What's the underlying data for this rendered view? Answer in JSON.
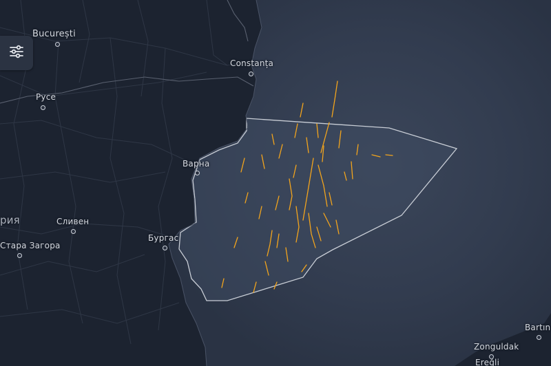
{
  "map": {
    "colors": {
      "land": "#1c2330",
      "sea": "#2c3547",
      "sea_deep": "#3a4559",
      "aoi": "#3d4a60",
      "border": "#c9ced6",
      "roads": "#343c4b",
      "tracks": "#f4a51c"
    },
    "labels": {
      "bucuresti": "București",
      "constanta": "Constanța",
      "ruse": "Русе",
      "varna": "Варна",
      "sliven": "Сливен",
      "burgas": "Бургас",
      "stara_zagora": "Стара Загора",
      "bulgaria": "рия",
      "zonguldak": "Zonguldak",
      "bartin": "Bartın",
      "eregli": "Ereğli"
    },
    "controls": {
      "filter_icon": "sliders-icon"
    }
  }
}
